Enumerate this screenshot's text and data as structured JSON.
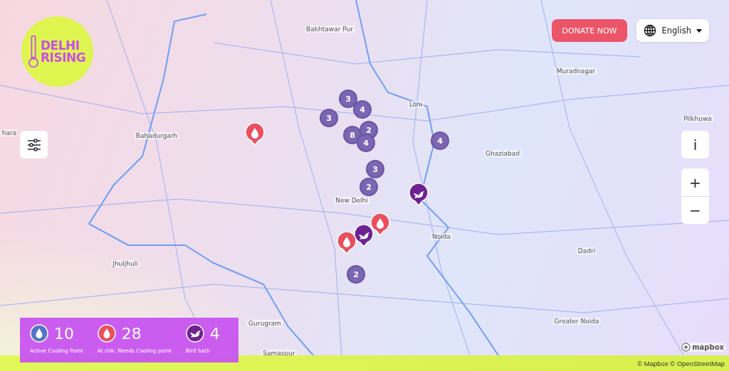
{
  "logo": {
    "line_1": "DELHI",
    "line_2": "RISING"
  },
  "header": {
    "donate_button": "DONATE NOW",
    "language": "English"
  },
  "map_controls": {
    "info": "i",
    "zoom_in": "+",
    "zoom_out": "−"
  },
  "places": [
    "Bakhtawar Pur",
    "Loni",
    "Muradnagar",
    "Pilkhuwa",
    "hara",
    "Bahadurgarh",
    "Ghaziabad",
    "New Delhi",
    "Noida",
    "Jhuljhuli",
    "Dadri",
    "Greater Noida",
    "Gurugram",
    "Samaspur"
  ],
  "clusters": [
    {
      "count": "3"
    },
    {
      "count": "4"
    },
    {
      "count": "3"
    },
    {
      "count": "8"
    },
    {
      "count": "2"
    },
    {
      "count": "4"
    },
    {
      "count": "3"
    },
    {
      "count": "2"
    },
    {
      "count": "4"
    },
    {
      "count": "2"
    }
  ],
  "markers": [
    {
      "kind": "risk"
    },
    {
      "kind": "bird"
    },
    {
      "kind": "risk"
    },
    {
      "kind": "bird"
    },
    {
      "kind": "risk"
    }
  ],
  "legend": [
    {
      "kind": "active",
      "count": "10",
      "label": "Active Cooling Point"
    },
    {
      "kind": "risk",
      "count": "28",
      "label": "At risk: Needs Cooling point"
    },
    {
      "kind": "bird",
      "count": "4",
      "label": "Bird bath"
    }
  ],
  "mapbox_logo": "mapbox",
  "attribution": "© Mapbox © OpenStreetMap"
}
